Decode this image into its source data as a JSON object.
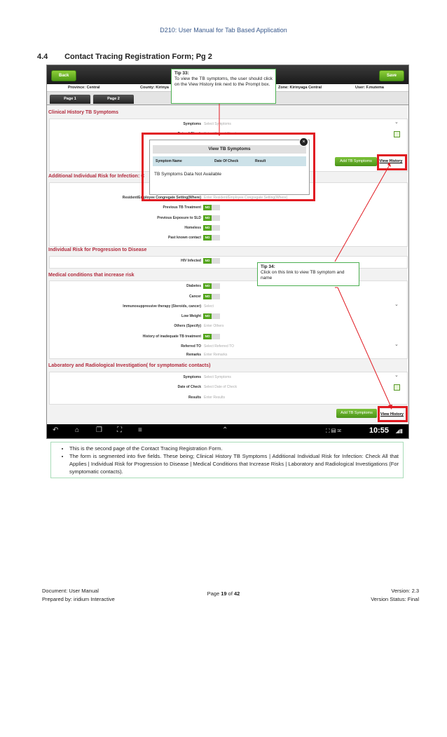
{
  "header": {
    "title": "D210: User Manual for Tab Based Application"
  },
  "section": {
    "number": "4.4",
    "title": "Contact Tracing Registration Form; Pg 2"
  },
  "app": {
    "back_label": "Back",
    "save_label": "Save",
    "province": "Province: Central",
    "county": "County: Kirinya",
    "zone": "Zone: Kirinyaga Central",
    "user": "User: F.mutema",
    "tabs": [
      "Page 1",
      "Page 2"
    ],
    "clinical": {
      "title": "Clinical History TB Symptoms",
      "symptoms_label": "Symptoms",
      "symptoms_ph": "Select Symptoms",
      "date_label": "Date of Check",
      "date_ph": "Select Date of Check",
      "add_label": "Add TB Symptoms",
      "history_label": "View History"
    },
    "modal": {
      "title": "View TB Symptoms",
      "columns": [
        "Symptom Name",
        "Date Of Check",
        "Result"
      ],
      "message": "TB Symptoms Data Not Available",
      "close": "×"
    },
    "additional": {
      "title": "Additional Individual Risk for Infection: C",
      "resident_label": "Resident/Employee Congregate Setting(Where)",
      "resident_ph": "Enter Resident/Employee Congregate Setting(Where)",
      "items": [
        "Previous TB Treatment",
        "Previous Exposure to SLD",
        "Homeless",
        "Past known contact"
      ]
    },
    "progression": {
      "title": "Individual Risk for Progression to Disease",
      "items": [
        "HIV Infected"
      ]
    },
    "medical": {
      "title": "Medical conditions that increase risk",
      "diabetes": "Diabetes",
      "cancer": "Cancer",
      "immuno_label": "Immunosuppressive therapy (Steroids, cancer)",
      "immuno_ph": "Select",
      "low_weight": "Low Weight",
      "others_label": "Others (Specify)",
      "others_ph": "Enter Others",
      "inadequate": "History of inadequate TB treatment",
      "referred_label": "Referred TO",
      "referred_ph": "Select Referred TO",
      "remarks_label": "Remarks",
      "remarks_ph": "Enter Remarks"
    },
    "lab": {
      "title": "Laboratory and Radiological Investigation( for symptomatic contacts)",
      "symptoms_label": "Symptoms",
      "symptoms_ph": "Select Symptoms",
      "date_label": "Date of Check",
      "date_ph": "Select Date of Check",
      "results_label": "Results",
      "results_ph": "Enter Results",
      "add_label": "Add TB Symptoms",
      "history_label": "View History"
    },
    "toggle_no": "NO",
    "toggle_off": "",
    "clock": "10:55"
  },
  "tips": {
    "tip33_title": "Tip 33:",
    "tip33_text": "To view the TB symptoms, the user should click on the View History link next to the Prompt box.",
    "tip34_title": "Tip 34:",
    "tip34_text": "Click on this link to view TB symptom and name"
  },
  "bullets": [
    "This is the second page of the Contact Tracing Registration Form.",
    "The form is segmented into five fields. These being; Clinical History TB Symptoms | Additional Individual Risk for Infection: Check All that Applies | Individual Risk for Progression to Disease | Medical Conditions that Increase Risks | Laboratory and Radiological Investigations (For symptomatic contacts)."
  ],
  "footer": {
    "doc": "Document: User Manual",
    "prepared": "Prepared by: iridium Interactive",
    "page_prefix": "Page ",
    "page_num": "19",
    "page_of": " of ",
    "page_total": "42",
    "version": "Version: 2.3",
    "status": "Version Status: Final"
  },
  "colors": {
    "accent_green": "#53a51c",
    "highlight_red": "#e11b22",
    "section_red": "#b22b3d"
  }
}
